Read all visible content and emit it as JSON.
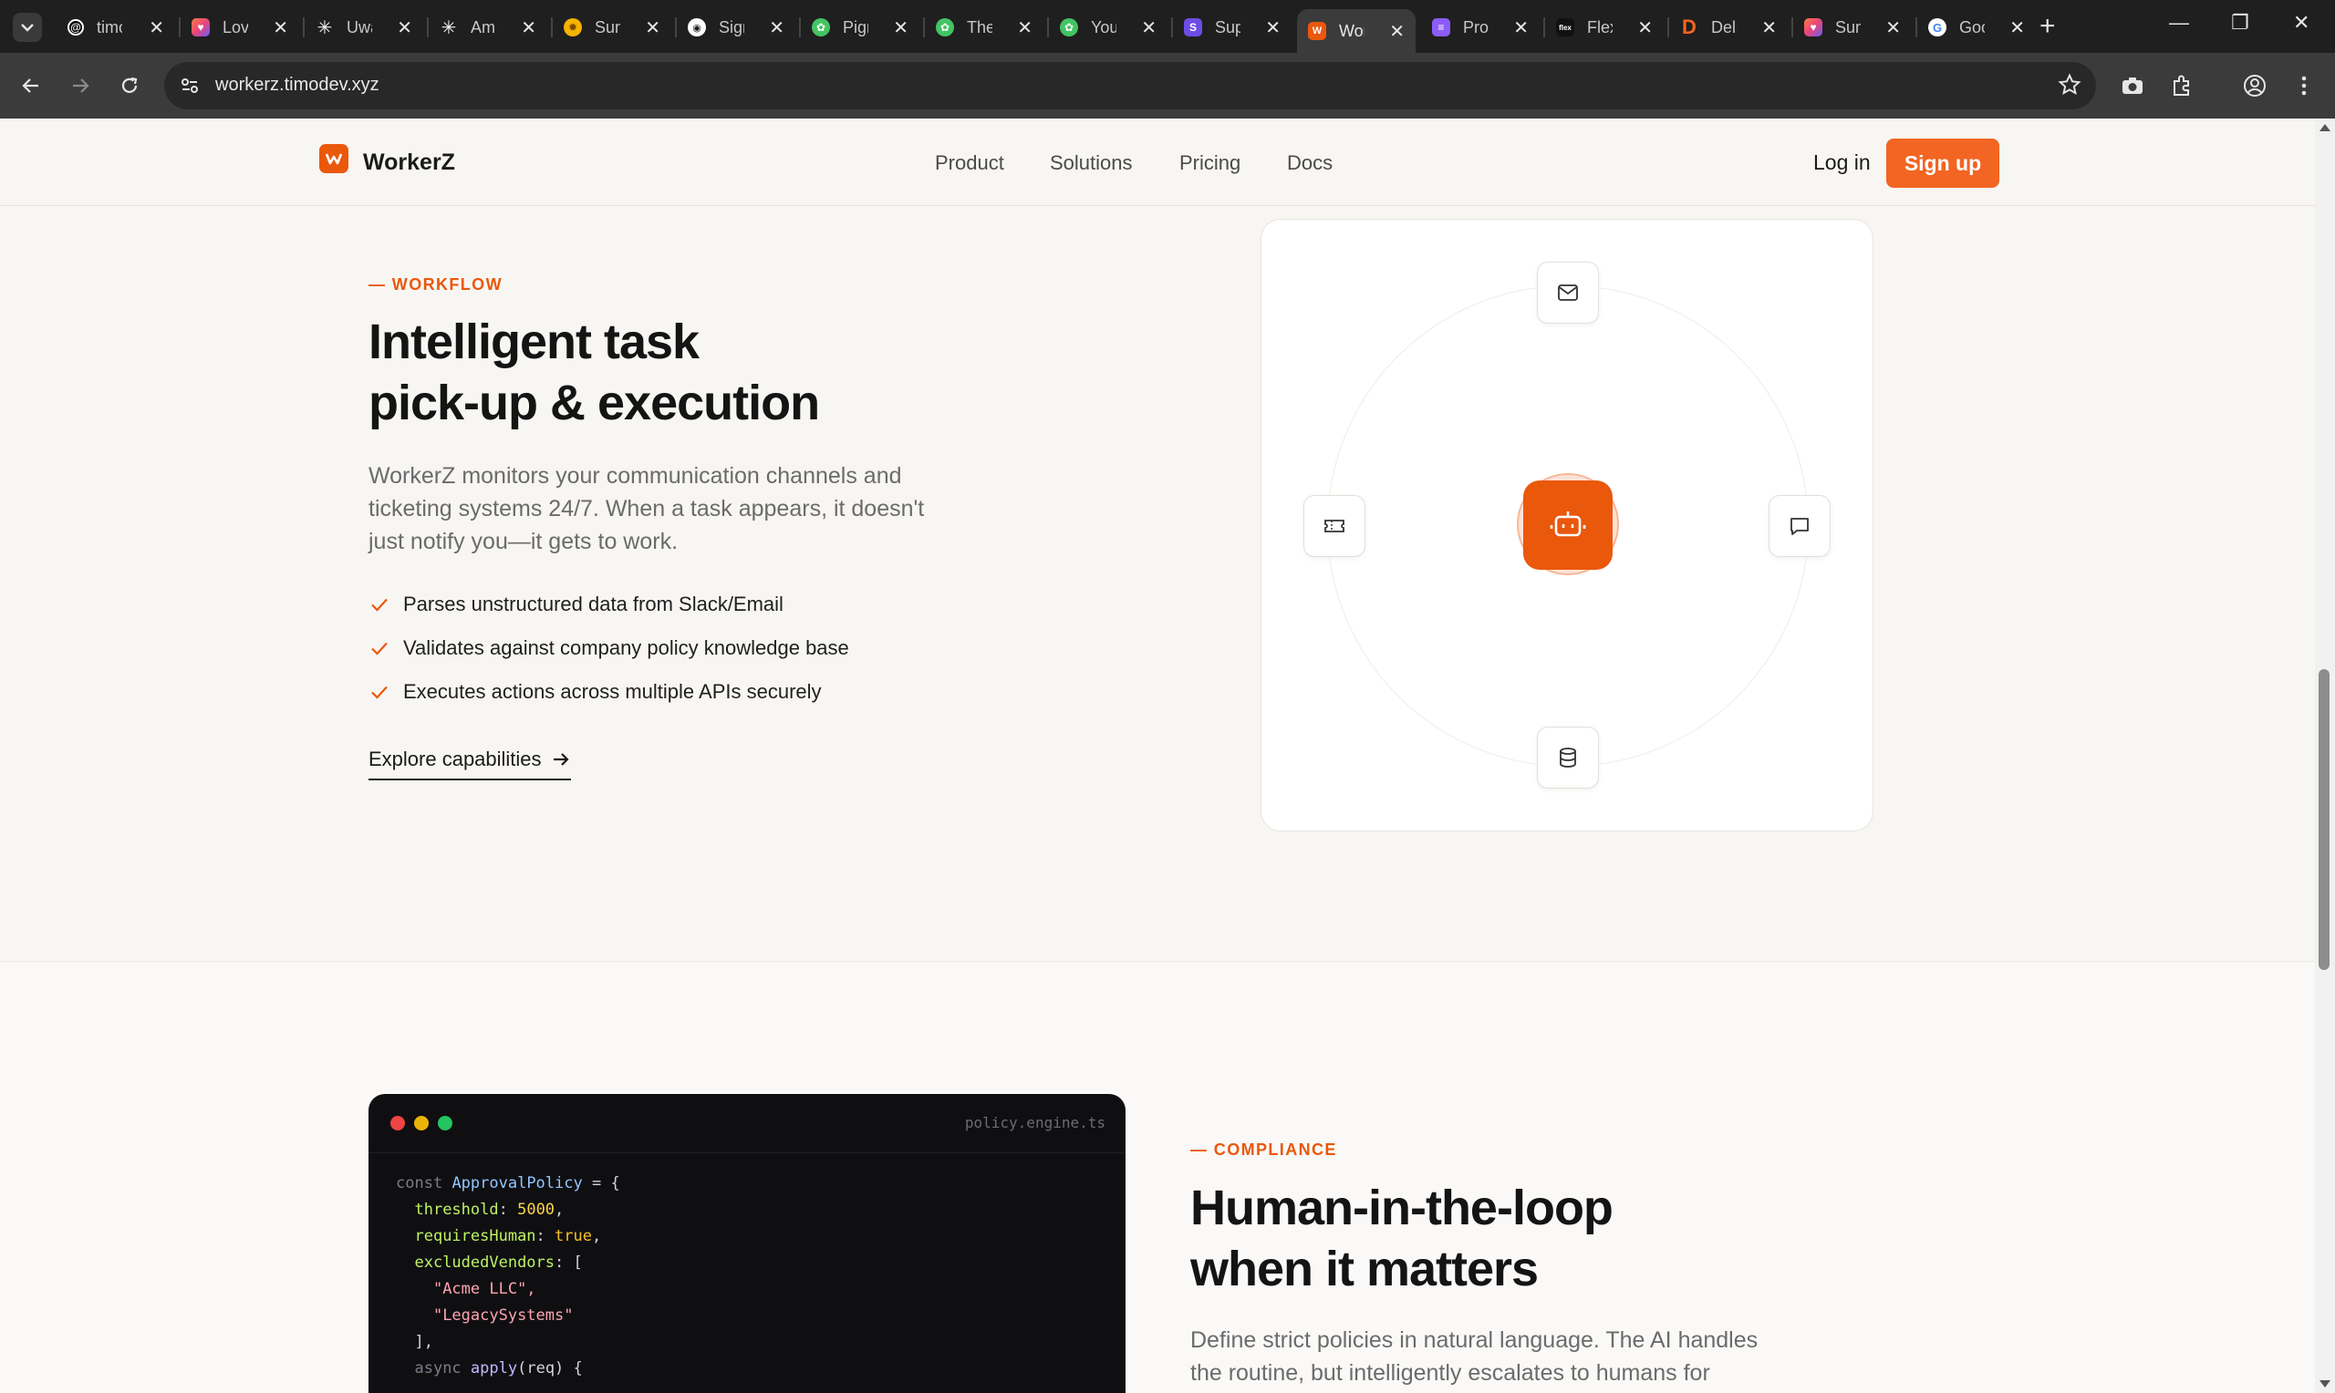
{
  "browser": {
    "tabs": [
      {
        "label": "timodev",
        "favicon": "threads-icon",
        "color": "#000000"
      },
      {
        "label": "Lovable",
        "favicon": "lovable-heart-icon",
        "color": "#e8457a"
      },
      {
        "label": "Uwazi",
        "favicon": "sparkle-icon",
        "color": "#ffffff"
      },
      {
        "label": "Ampcode",
        "favicon": "sparkle-icon",
        "color": "#ffffff"
      },
      {
        "label": "Sunrise",
        "favicon": "sun-icon",
        "color": "#f5b400"
      },
      {
        "label": "Sign in",
        "favicon": "circle-icon",
        "color": "#ffffff"
      },
      {
        "label": "Pigment",
        "favicon": "chatgpt-icon",
        "color": "#43c463"
      },
      {
        "label": "The",
        "favicon": "chatgpt-icon",
        "color": "#43c463"
      },
      {
        "label": "Your",
        "favicon": "chatgpt-icon",
        "color": "#43c463"
      },
      {
        "label": "Supabase",
        "favicon": "s-icon",
        "color": "#6d4ce6"
      },
      {
        "label": "WorkerZ",
        "favicon": "workerz-icon",
        "color": "#ea580c",
        "active": true
      },
      {
        "label": "Product",
        "favicon": "doc-icon",
        "color": "#8b5cf6"
      },
      {
        "label": "Flex",
        "favicon": "flex-icon",
        "color": "#111111"
      },
      {
        "label": "Deli",
        "favicon": "d-icon",
        "color": "#f26522"
      },
      {
        "label": "Sunrise",
        "favicon": "lovable-heart-icon",
        "color": "#e8457a"
      },
      {
        "label": "Google",
        "favicon": "google-icon",
        "color": "#ffffff"
      }
    ],
    "url": "workerz.timodev.xyz"
  },
  "site": {
    "brand": "WorkerZ",
    "nav": [
      "Product",
      "Solutions",
      "Pricing",
      "Docs"
    ],
    "login": "Log in",
    "signup": "Sign up"
  },
  "workflow": {
    "eyebrow": "— WORKFLOW",
    "title_line1": "Intelligent task",
    "title_line2": "pick-up & execution",
    "lead_line1": "WorkerZ monitors your communication channels and",
    "lead_line2": "ticketing systems 24/7. When a task appears, it doesn't",
    "lead_line3": "just notify you—it gets to work.",
    "features": [
      "Parses unstructured data from Slack/Email",
      "Validates against company policy knowledge base",
      "Executes actions across multiple APIs securely"
    ],
    "cta": "Explore capabilities",
    "orbit": {
      "top_icon": "mail-icon",
      "left_icon": "ticket-icon",
      "right_icon": "message-icon",
      "bottom_icon": "database-icon",
      "center_icon": "bot-icon"
    }
  },
  "compliance": {
    "eyebrow": "— COMPLIANCE",
    "title_line1": "Human-in-the-loop",
    "title_line2": "when it matters",
    "lead_line1": "Define strict policies in natural language. The AI handles",
    "lead_line2": "the routine, but intelligently escalates to humans for",
    "code_filename": "policy.engine.ts",
    "code": {
      "l1_kw": "const",
      "l1_name": "ApprovalPolicy",
      "l1_rest": " = {",
      "l2_key": "threshold",
      "l2_val": "5000",
      "l3_key": "requiresHuman",
      "l3_val": "true",
      "l4_key": "excludedVendors",
      "l4_rest": ": [",
      "l5": "\"Acme LLC\",",
      "l6": "\"LegacySystems\"",
      "l7": "],",
      "l8_kw": "async",
      "l8_fn": "apply",
      "l8_rest": "(req) {"
    }
  },
  "colors": {
    "accent": "#ea580c",
    "signup_bg": "#f26522",
    "code_bg": "#0f0f12"
  }
}
